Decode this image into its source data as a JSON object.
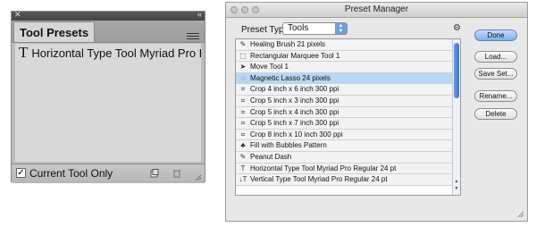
{
  "tool_presets": {
    "tab_label": "Tool Presets",
    "item": {
      "icon": "type-tool-icon",
      "label": "Horizontal Type Tool Myriad Pro R"
    },
    "footer": {
      "checkbox_checked": true,
      "checkbox_label": "Current Tool Only"
    }
  },
  "preset_manager": {
    "title": "Preset Manager",
    "preset_type_label": "Preset Type:",
    "preset_type_value": "Tools",
    "items": [
      {
        "icon": "healing-brush-icon",
        "label": "Healing Brush 21 pixels",
        "selected": false
      },
      {
        "icon": "rectangular-marquee-icon",
        "label": "Rectangular Marquee Tool 1",
        "selected": false
      },
      {
        "icon": "move-tool-icon",
        "label": "Move Tool 1",
        "selected": false
      },
      {
        "icon": "magnetic-lasso-icon",
        "label": "Magnetic Lasso 24 pixels",
        "selected": true
      },
      {
        "icon": "crop-icon",
        "label": "Crop 4 inch x 6 inch 300 ppi",
        "selected": false
      },
      {
        "icon": "crop-icon",
        "label": "Crop 5 inch x 3 inch 300 ppi",
        "selected": false
      },
      {
        "icon": "crop-icon",
        "label": "Crop 5 inch x 4 inch 300 ppi",
        "selected": false
      },
      {
        "icon": "crop-icon",
        "label": "Crop 5 inch x 7 inch 300 ppi",
        "selected": false
      },
      {
        "icon": "crop-icon",
        "label": "Crop 8 inch x 10 inch 300 ppi",
        "selected": false
      },
      {
        "icon": "pattern-stamp-icon",
        "label": "Fill with Bubbles Pattern",
        "selected": false
      },
      {
        "icon": "brush-icon",
        "label": "Peanut Dash",
        "selected": false
      },
      {
        "icon": "horizontal-type-icon",
        "label": "Horizontal Type Tool Myriad Pro Regular 24 pt",
        "selected": false
      },
      {
        "icon": "vertical-type-icon",
        "label": "Vertical Type Tool Myriad Pro Regular 24 pt",
        "selected": false
      }
    ],
    "buttons": {
      "done": "Done",
      "load": "Load...",
      "save_set": "Save Set...",
      "rename": "Rename...",
      "delete": "Delete"
    }
  },
  "colors": {
    "selection": "#b8d6f5",
    "primary_button": "#7eaee8",
    "scroll_thumb": "#3b74d0"
  }
}
